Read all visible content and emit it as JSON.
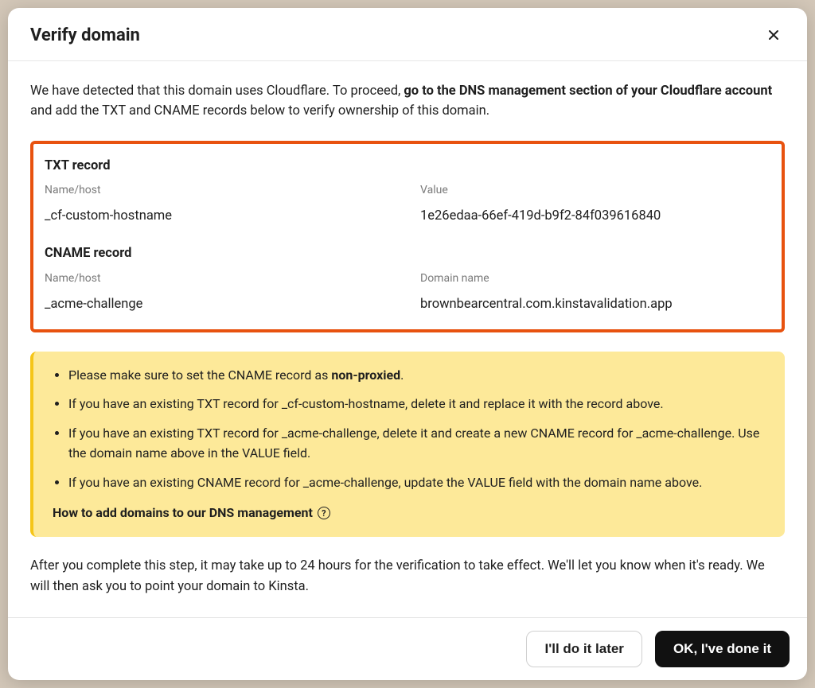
{
  "header": {
    "title": "Verify domain"
  },
  "intro": {
    "part1": "We have detected that this domain uses Cloudflare. To proceed, ",
    "bold": "go to the DNS management section of your Cloudflare account",
    "part2": " and add the TXT and CNAME records below to verify ownership of this domain."
  },
  "records": {
    "txt_title": "TXT record",
    "txt_name_label": "Name/host",
    "txt_name_value": "_cf-custom-hostname",
    "txt_value_label": "Value",
    "txt_value_value": "1e26edaa-66ef-419d-b9f2-84f039616840",
    "cname_title": "CNAME record",
    "cname_name_label": "Name/host",
    "cname_name_value": "_acme-challenge",
    "cname_value_label": "Domain name",
    "cname_value_value": "brownbearcentral.com.kinstavalidation.app"
  },
  "warning": {
    "item1_pre": "Please make sure to set the CNAME record as ",
    "item1_bold": "non-proxied",
    "item1_post": ".",
    "item2": "If you have an existing TXT record for _cf-custom-hostname, delete it and replace it with the record above.",
    "item3": "If you have an existing TXT record for _acme-challenge, delete it and create a new CNAME record for _acme-challenge. Use the domain name above in the VALUE field.",
    "item4": "If you have an existing CNAME record for _acme-challenge, update the VALUE field with the domain name above.",
    "help_link": "How to add domains to our DNS management"
  },
  "after": "After you complete this step, it may take up to 24 hours for the verification to take effect. We'll let you know when it's ready. We will then ask you to point your domain to Kinsta.",
  "footer": {
    "later": "I'll do it later",
    "done": "OK, I've done it"
  }
}
